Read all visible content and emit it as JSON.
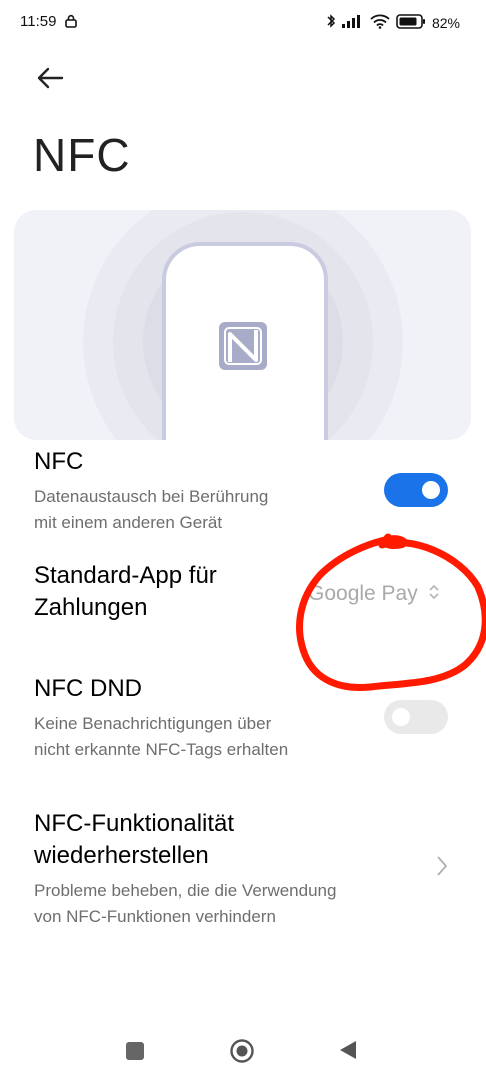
{
  "status_bar": {
    "time": "11:59",
    "battery": "82%"
  },
  "header": {
    "title": "NFC"
  },
  "settings": {
    "nfc": {
      "title": "NFC",
      "subtitle_line1": "Datenaustausch bei Berührung",
      "subtitle_line2": "mit einem anderen Gerät",
      "enabled": true
    },
    "payment": {
      "title_line1": "Standard-App für",
      "title_line2": "Zahlungen",
      "value": "Google Pay"
    },
    "nfc_dnd": {
      "title": "NFC DND",
      "subtitle_line1": "Keine Benachrichtigungen über",
      "subtitle_line2": "nicht erkannte NFC-Tags erhalten",
      "enabled": false
    },
    "restore": {
      "title_line1": "NFC-Funktionalität",
      "title_line2": "wiederherstellen",
      "subtitle_line1": "Probleme beheben, die die Verwendung",
      "subtitle_line2": "von NFC-Funktionen verhindern"
    }
  },
  "colors": {
    "accent": "#1a73e8",
    "annotation": "#ff1a00"
  }
}
